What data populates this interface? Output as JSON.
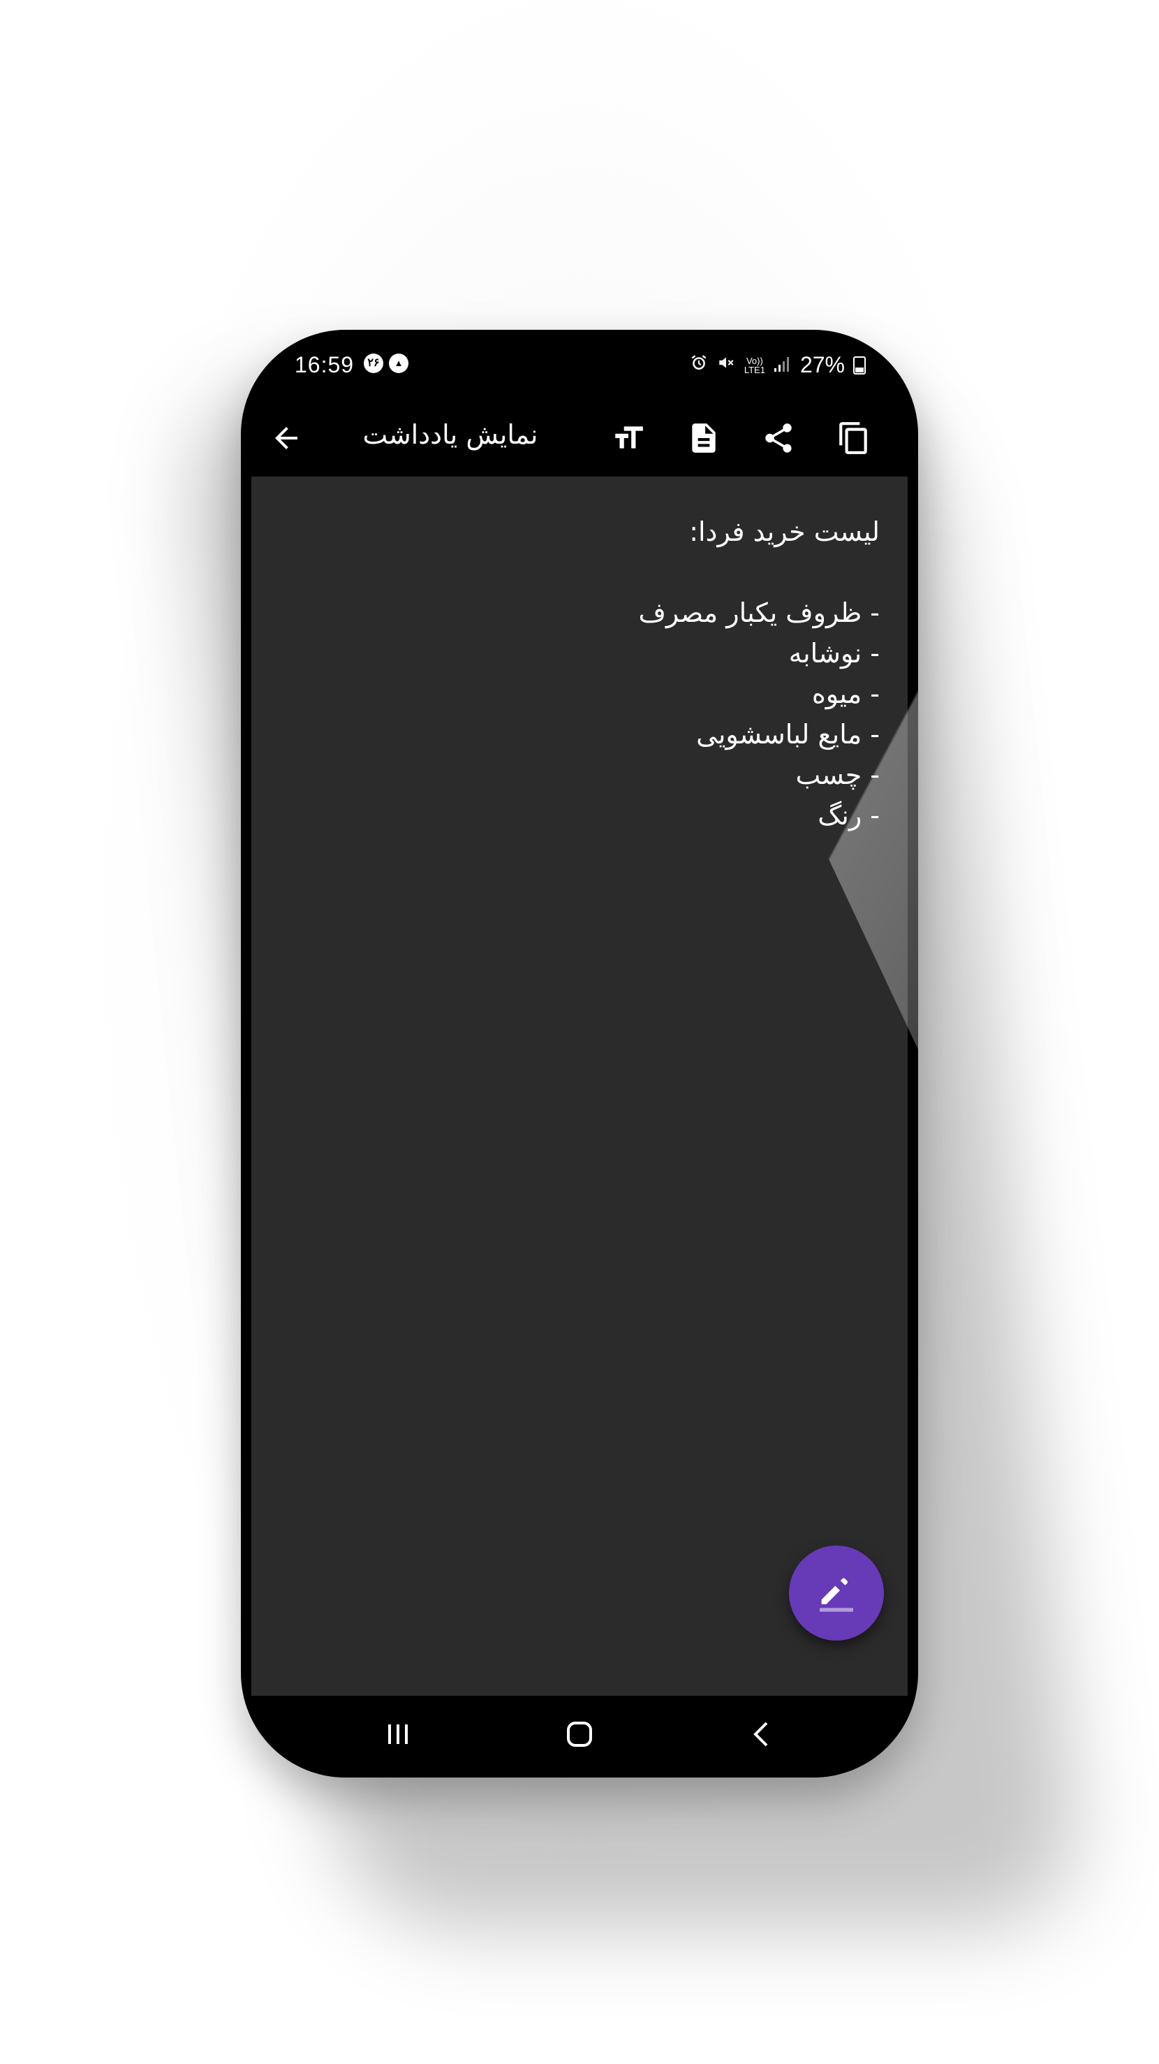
{
  "status_bar": {
    "time": "16:59",
    "notification_1": "۲۶",
    "notification_2": "▲",
    "battery": "27%",
    "icons": [
      "alarm-icon",
      "mute-icon",
      "volte-icon",
      "signal-icon",
      "battery-icon"
    ],
    "network_label_top": "Vo))",
    "network_label_bottom": "LTE1"
  },
  "app_bar": {
    "title": "نمایش یادداشت",
    "actions": [
      "text-size-icon",
      "document-icon",
      "share-icon",
      "copy-icon"
    ]
  },
  "note": {
    "lines": [
      "لیست خرید فردا:",
      "",
      "- ظروف یکبار مصرف",
      "- نوشابه",
      "- میوه",
      "- مایع لباسشویی",
      "- چسب",
      "- رنگ"
    ]
  },
  "fab": {
    "icon": "edit-icon",
    "color": "#673ab7"
  },
  "nav_bar": {
    "buttons": [
      "recents-icon",
      "home-icon",
      "back-nav-icon"
    ]
  },
  "colors": {
    "background": "#2b2b2b",
    "bar": "#000000",
    "accent": "#673ab7"
  }
}
